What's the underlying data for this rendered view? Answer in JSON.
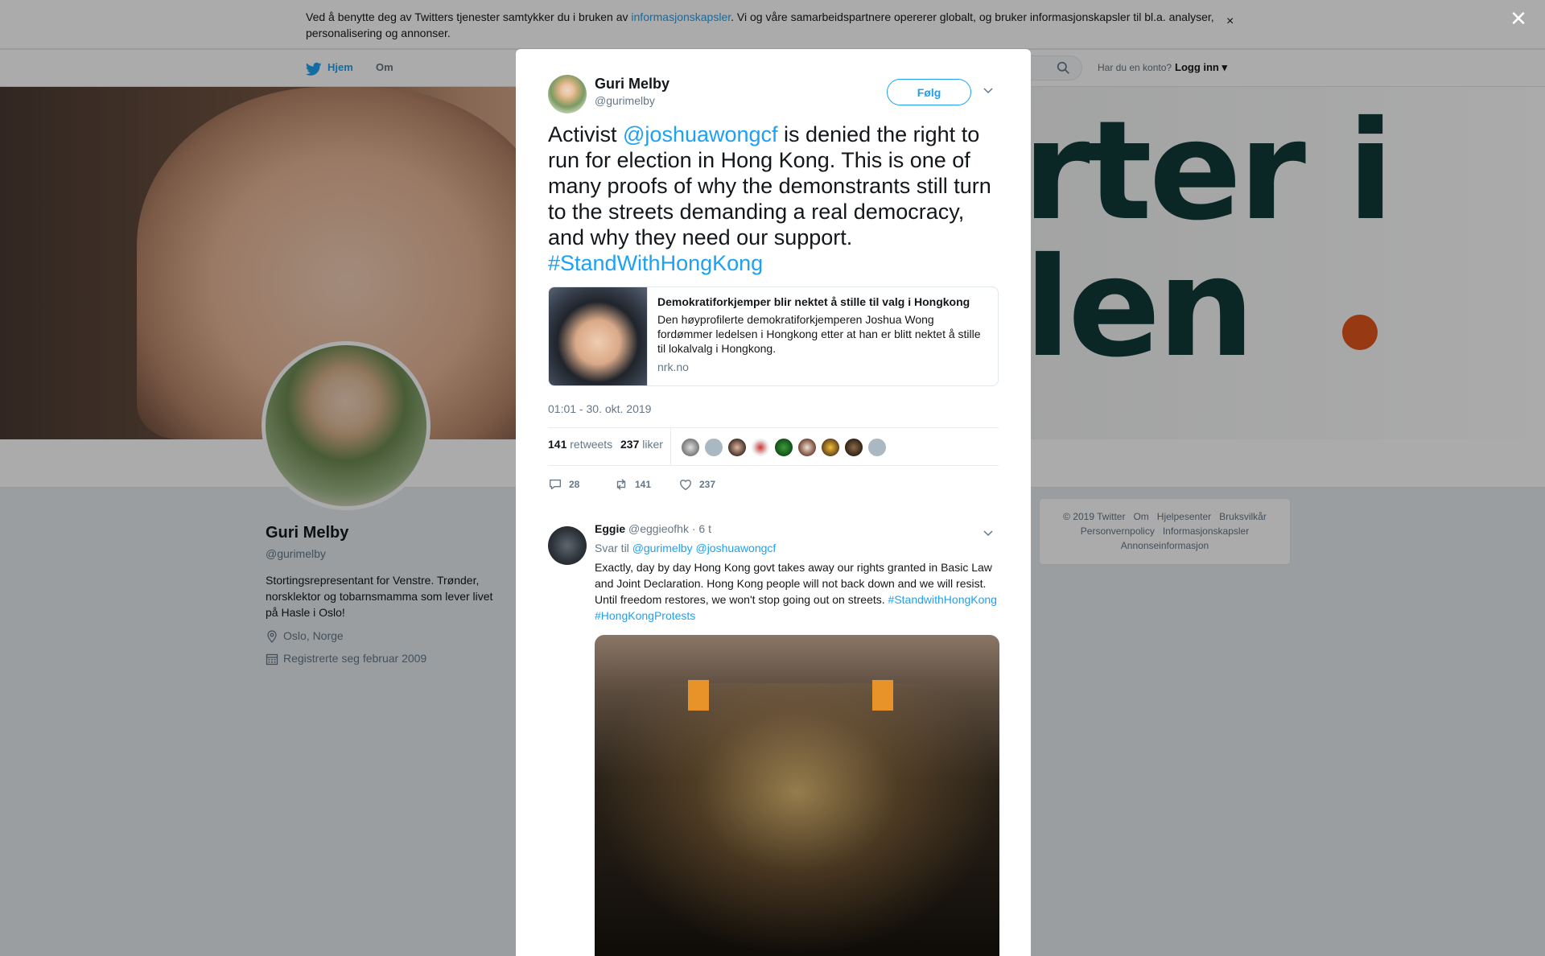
{
  "cookie": {
    "text_before": "Ved å benytte deg av Twitters tjenester samtykker du i bruken av ",
    "link": "informasjonskapsler",
    "text_after": ". Vi og våre samarbeidspartnere opererer globalt, og bruker informasjonskapsler til bl.a. analyser, personalisering og annonser.",
    "close": "×"
  },
  "nav": {
    "home": "Hjem",
    "about": "Om",
    "account_prompt": "Har du en konto?",
    "login": "Logg inn"
  },
  "header": {
    "text_line1": "arter i",
    "text_line2": "olen"
  },
  "profile": {
    "name": "Guri Melby",
    "handle": "@gurimelby",
    "bio": "Stortingsrepresentant for Venstre. Trønder, norsklektor og tobarnsmamma som lever livet på Hasle i Oslo!",
    "location": "Oslo, Norge",
    "joined": "Registrerte seg februar 2009"
  },
  "footer": {
    "links": [
      "© 2019 Twitter",
      "Om",
      "Hjelpesenter",
      "Bruksvilkår",
      "Personvernpolicy",
      "Informasjonskapsler",
      "Annonseinformasjon"
    ]
  },
  "overlay": {
    "close": "✕"
  },
  "tweet": {
    "name": "Guri Melby",
    "handle": "@gurimelby",
    "follow": "Følg",
    "text_1": "Activist ",
    "mention": "@joshuawongcf",
    "text_2": " is denied the right to run for election in Hong Kong. This is one of many proofs of why the demonstrants still turn to the streets demanding a real democracy, and why they need our support. ",
    "hashtag": "#StandWithHongKong",
    "card": {
      "title": "Demokratiforkjemper blir nektet å stille til valg i Hongkong",
      "description": "Den høyprofilerte demokratiforkjemperen Joshua Wong fordømmer ledelsen i Hongkong etter at han er blitt nektet å stille til lokalvalg i Hongkong.",
      "domain": "nrk.no"
    },
    "date": "01:01 - 30. okt. 2019",
    "retweets_count": "141",
    "retweets_label": "retweets",
    "likes_count": "237",
    "likes_label": "liker",
    "actions": {
      "replies": "28",
      "retweets": "141",
      "likes": "237"
    }
  },
  "reply": {
    "name": "Eggie",
    "handle": "@eggieofhk",
    "time": "· 6 t",
    "reply_to_label": "Svar til",
    "reply_to_1": "@gurimelby",
    "reply_to_2": "@joshuawongcf",
    "text": "Exactly, day by day Hong Kong govt takes away our rights granted in Basic Law and Joint Declaration. Hong Kong people will not back down and we will resist. Until freedom restores, we won't stop going out on streets. ",
    "hashtag_1": "#StandwithHongKong",
    "hashtag_2": "#HongKongProtests"
  },
  "colors": {
    "accent": "#1da1f2",
    "text": "#14171a",
    "muted": "#657786",
    "overlay": "rgba(0,0,0,0.33)"
  }
}
